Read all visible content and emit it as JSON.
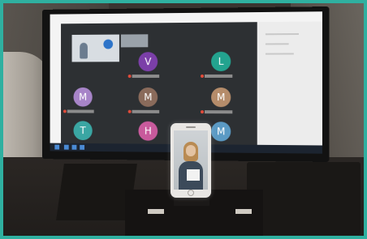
{
  "meeting_tiles": [
    {
      "initial": "V",
      "color": "#7b3fa8"
    },
    {
      "initial": "L",
      "color": "#23a38f"
    },
    {
      "initial": "M",
      "color": "#a784c8"
    },
    {
      "initial": "M",
      "color": "#8a6b5b"
    },
    {
      "initial": "M",
      "color": "#b58c6a"
    },
    {
      "initial": "T",
      "color": "#3aa6a3"
    },
    {
      "initial": "H",
      "color": "#c85a9c"
    },
    {
      "initial": "M",
      "color": "#5b9ac4"
    }
  ],
  "colors": {
    "frame": "#2fb0a0",
    "meeting_background": "#2d3033",
    "taskbar": "#1c2430"
  }
}
